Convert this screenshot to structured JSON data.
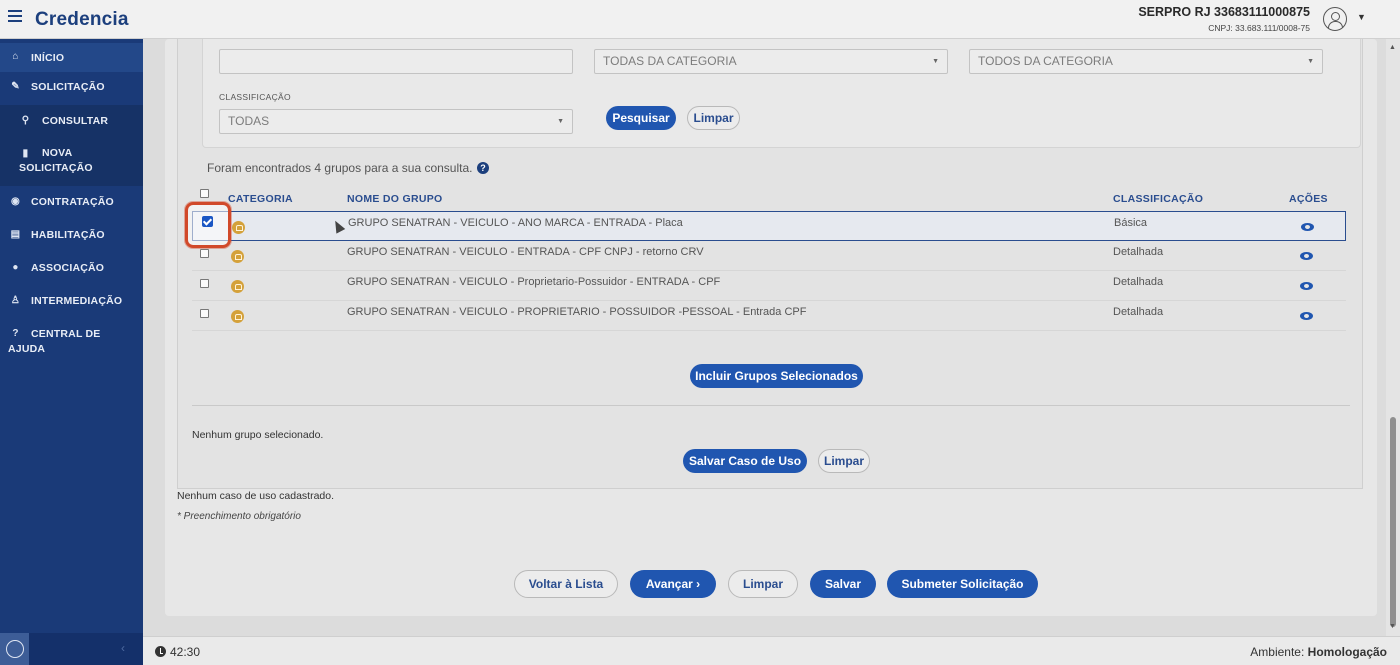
{
  "app": {
    "title": "Credencia"
  },
  "user": {
    "name": "SERPRO RJ 33683111000875",
    "cnpj": "CNPJ: 33.683.111/0008-75"
  },
  "sidebar": {
    "items": [
      {
        "label": "INÍCIO",
        "icon": "home-icon"
      },
      {
        "label": "SOLICITAÇÃO",
        "icon": "edit-icon"
      },
      {
        "label": "CONSULTAR",
        "icon": "search-icon"
      },
      {
        "label_line1": "NOVA",
        "label_line2": "SOLICITAÇÃO",
        "icon": "file-icon"
      },
      {
        "label": "CONTRATAÇÃO",
        "icon": "handshake-icon"
      },
      {
        "label": "HABILITAÇÃO",
        "icon": "id-card-icon"
      },
      {
        "label": "ASSOCIAÇÃO",
        "icon": "users-icon"
      },
      {
        "label": "INTERMEDIAÇÃO",
        "icon": "person-icon"
      },
      {
        "label_line1": "CENTRAL DE",
        "label_line2": "AJUDA",
        "icon": "help-icon"
      }
    ]
  },
  "filters": {
    "categoria_value": "TODAS DA CATEGORIA",
    "nivel_value": "TODOS DA CATEGORIA",
    "classificacao_label": "CLASSIFICAÇÃO",
    "classificacao_value": "TODAS",
    "search_button": "Pesquisar",
    "clear_button": "Limpar"
  },
  "results": {
    "summary": "Foram encontrados 4 grupos para a sua consulta."
  },
  "table": {
    "headers": {
      "categoria": "CATEGORIA",
      "nome": "NOME DO GRUPO",
      "classificacao": "CLASSIFICAÇÃO",
      "acoes": "AÇÕES"
    },
    "rows": [
      {
        "name": "GRUPO SENATRAN - VEICULO - ANO MARCA - ENTRADA - Placa",
        "classificacao": "Básica",
        "checked": true
      },
      {
        "name": "GRUPO SENATRAN - VEICULO - ENTRADA - CPF CNPJ - retorno CRV",
        "classificacao": "Detalhada",
        "checked": false
      },
      {
        "name": "GRUPO SENATRAN - VEICULO - Proprietario-Possuidor - ENTRADA - CPF",
        "classificacao": "Detalhada",
        "checked": false
      },
      {
        "name": "GRUPO SENATRAN - VEICULO - PROPRIETARIO - POSSUIDOR -PESSOAL - Entrada CPF",
        "classificacao": "Detalhada",
        "checked": false
      }
    ],
    "include_button": "Incluir Grupos Selecionados"
  },
  "selection": {
    "empty_text": "Nenhum grupo selecionado.",
    "save_button": "Salvar Caso de Uso",
    "clear_button": "Limpar"
  },
  "usecases": {
    "empty_text": "Nenhum caso de uso cadastrado.",
    "required_note": "* Preenchimento obrigatório"
  },
  "actions": {
    "back": "Voltar à Lista",
    "next": "Avançar ›",
    "clear": "Limpar",
    "save": "Salvar",
    "submit": "Submeter Solicitação"
  },
  "footer": {
    "timer": "42:30",
    "env_label": "Ambiente:",
    "env_value": "Homologação"
  }
}
